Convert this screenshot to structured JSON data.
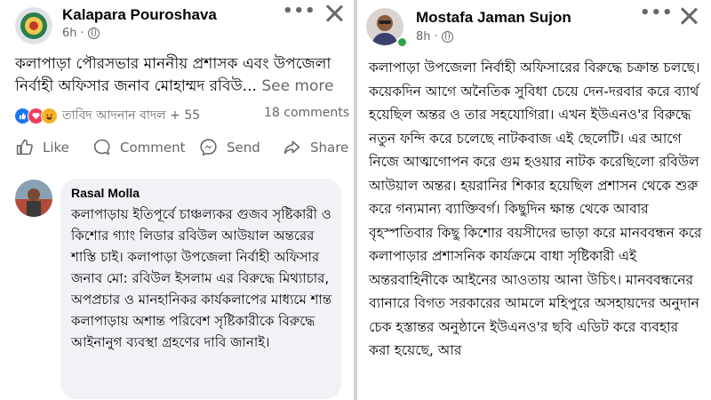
{
  "left_post": {
    "author": "Kalapara Pouroshava",
    "time": "6h",
    "body": "কলাপাড়া পৌরসভার মাননীয় প্রশাসক এবং উপজেলা নির্বাহী অফিসার জনাব মোহাম্মদ রবিউ...",
    "see_more": "See more",
    "reactors": "তাবিদ আদনান বাদল + 55",
    "comments_count": "18 comments",
    "actions": {
      "like": "Like",
      "comment": "Comment",
      "send": "Send",
      "share": "Share"
    },
    "comment": {
      "author": "Rasal Molla",
      "text": "কলাপাড়ায় ইতিপূর্বে চাঞ্চল্যকর গুজব সৃষ্টিকারী ও কিশোর গ্যাং লিডার রবিউল আউয়াল অন্তরের শাস্তি চাই। কলাপাড়া উপজেলা নির্বাহী অফিসার জনাব মো: রবিউল ইসলাম এর বিরুদ্ধে মিথ্যাচার, অপপ্রচার ও মানহানিকর কার্যকলাপের মাধ্যমে শান্ত কলাপাড়ায় অশান্ত পরিবেশ সৃষ্টিকারীকে বিরুদ্ধে আইনানুগ ব্যবস্থা গ্রহণের দাবি জানাই।"
    }
  },
  "right_post": {
    "author": "Mostafa Jaman Sujon",
    "time": "8h",
    "body": "কলাপাড়া উপজেলা নির্বাহী অফিসারের বিরুদ্ধে চক্রান্ত চলছে। কয়েকদিন আগে অনৈতিক সুবিধা চেয়ে দেন-দরবার করে ব্যার্থ হয়েছিল অন্তর ও তার সহযোগিরা। এখন ইউএনও'র বিরুদ্ধে নতুন ফন্দি করে চলেছে নাটকবাজ এই ছেলেটি। এর আগে নিজে আত্মগোপন করে গুম হওয়ার নাটক করেছিলো রবিউল আউয়াল অন্তর। হয়রানির শিকার হয়েছিল প্রশাসন থেকে শুরু করে গন্যমান্য ব্যাক্তিবর্গ। কিছুদিন ক্ষান্ত থেকে আবার বৃহস্পতিবার কিছু কিশোর বয়সীদের ভাড়া করে মানববন্ধন করে কলাপাড়ার প্রশাসনিক কার্যক্রমে বাধা সৃষ্টিকারী এই অন্তরবাহিনীকে আইনের আওতায় আনা উচিৎ। মানববন্ধনের ব্যানারে বিগত সরকারের আমলে মহিপুরে অসহায়দের অনুদান চেক হস্তান্তর অনুষ্ঠানে ইউএনও'র ছবি এডিট করে ব্যবহার করা হয়েছে, আর"
  },
  "colors": {
    "like_blue": "#1877f2",
    "love_red": "#f33e58",
    "haha_yellow": "#f7b125",
    "online_green": "#31a24c"
  }
}
